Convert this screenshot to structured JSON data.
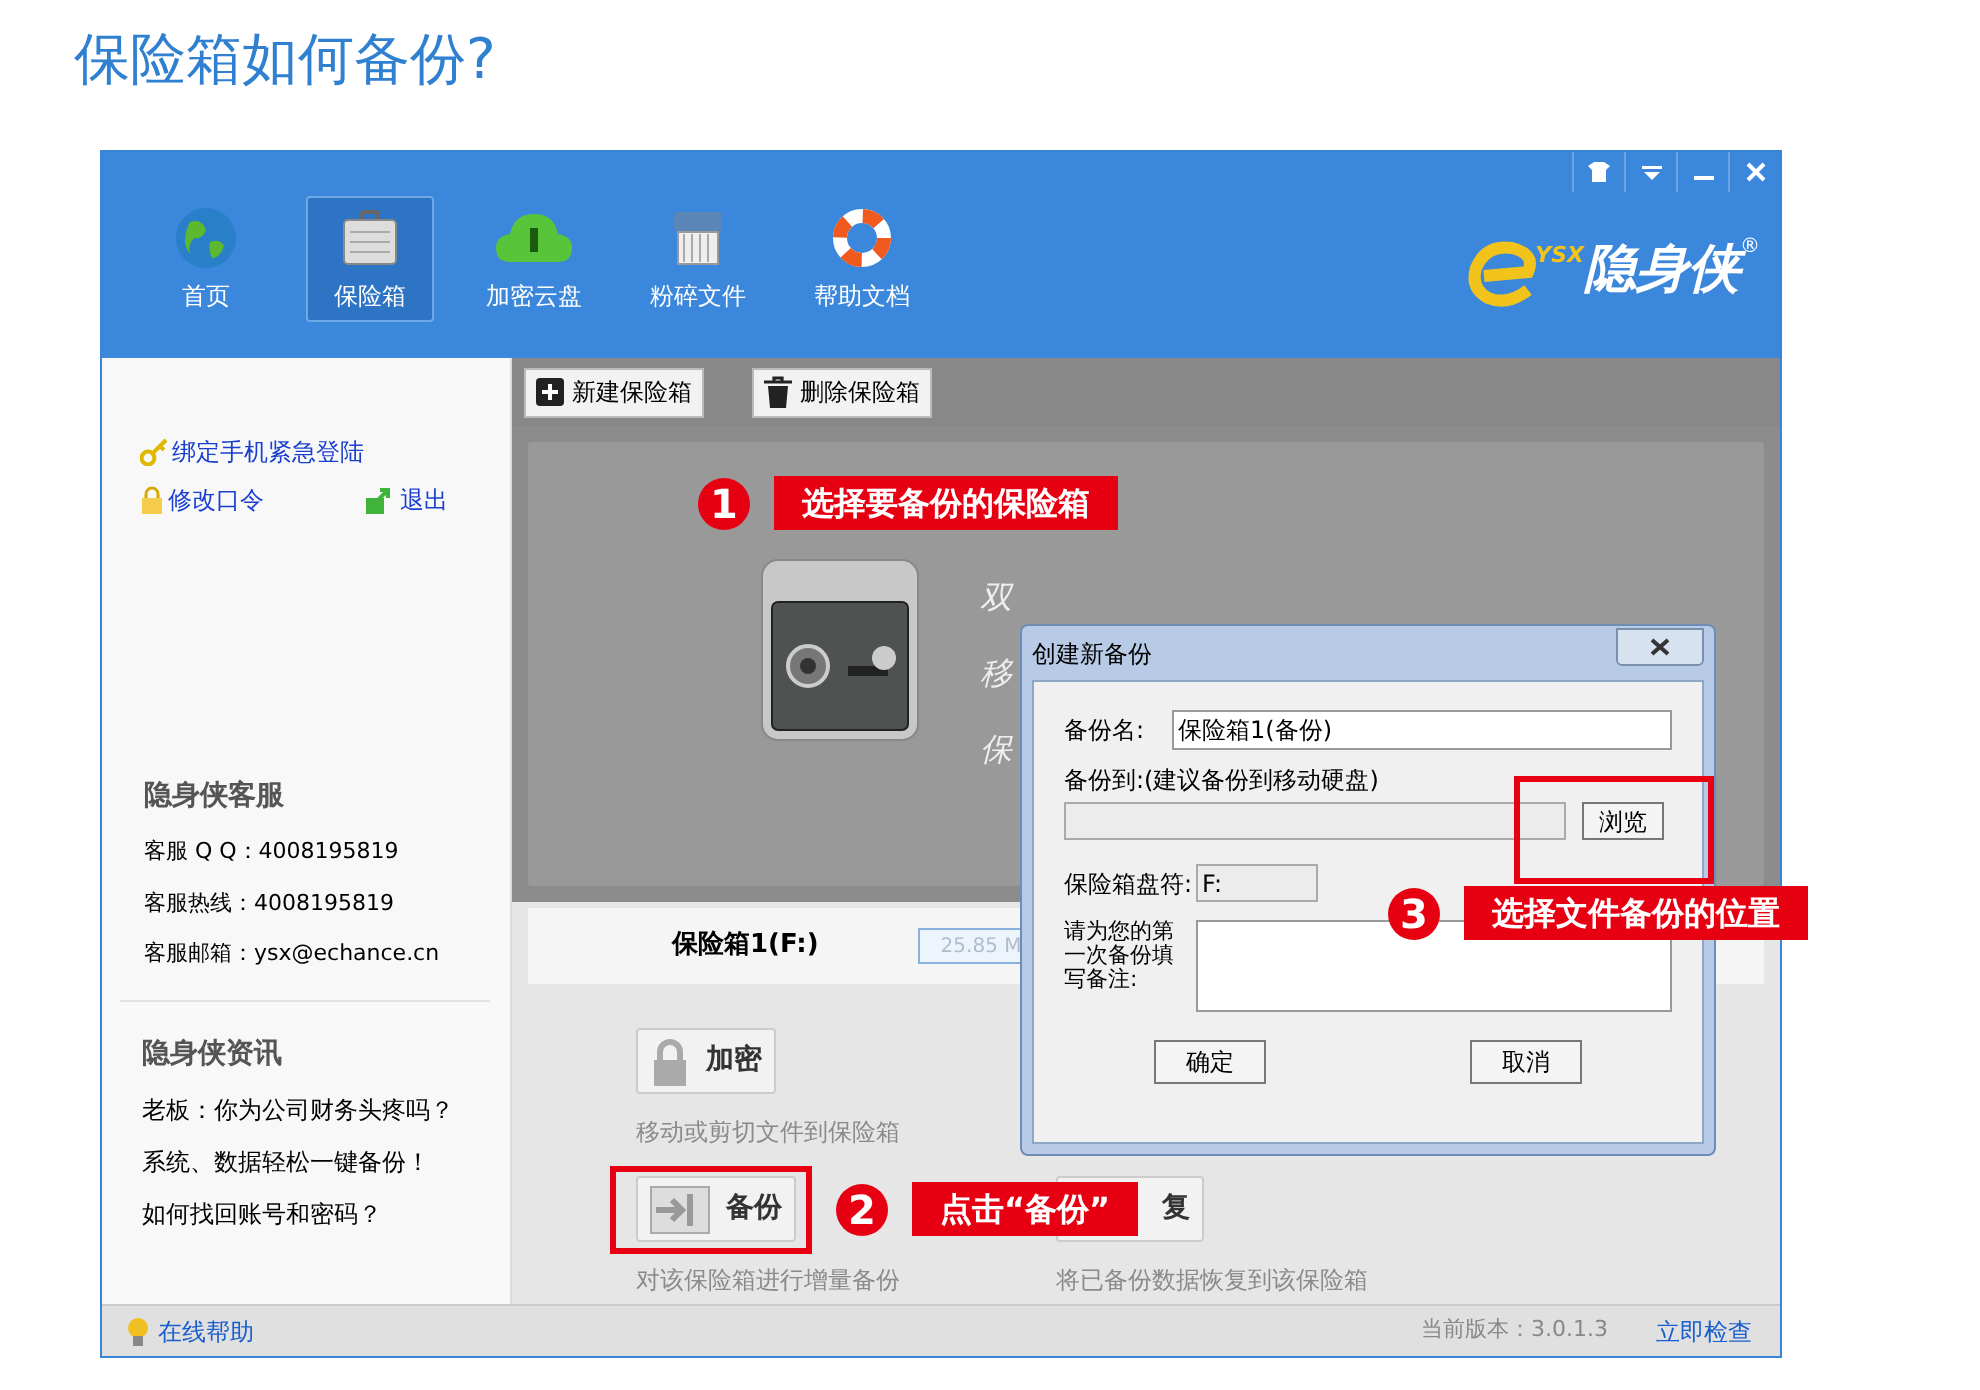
{
  "page_title": "保险箱如何备份?",
  "toolbar": [
    {
      "label": "首页",
      "selected": false
    },
    {
      "label": "保险箱",
      "selected": true
    },
    {
      "label": "加密云盘",
      "selected": false
    },
    {
      "label": "粉碎文件",
      "selected": false
    },
    {
      "label": "帮助文档",
      "selected": false
    }
  ],
  "logo": {
    "tag": "YSX",
    "name": "隐身侠",
    "reg": "®"
  },
  "sidebar": {
    "links": [
      "绑定手机紧急登陆",
      "修改口令",
      "退出"
    ],
    "service": {
      "title": "隐身侠客服",
      "lines": [
        "客服 Q Q：4008195819",
        "客服热线：4008195819",
        "客服邮箱：ysx@echance.cn"
      ]
    },
    "news": {
      "title": "隐身侠资讯",
      "items": [
        "老板：你为公司财务头疼吗？",
        "系统、数据轻松一键备份！",
        "如何找回账号和密码？"
      ]
    }
  },
  "main": {
    "toolbar_buttons": [
      "新建保险箱",
      "删除保险箱"
    ],
    "banner_lines": [
      "双",
      "移",
      "保"
    ],
    "safe": {
      "name": "保险箱1(F:)",
      "size": "25.85 M"
    },
    "actions": [
      {
        "label": "加密",
        "description": "移动或剪切文件到保险箱"
      },
      {
        "label": "备份",
        "description": "对该保险箱进行增量备份"
      },
      {
        "label": "复",
        "description": "将已备份数据恢复到该保险箱"
      }
    ]
  },
  "status_bar": {
    "help": "在线帮助",
    "version": "当前版本：3.0.1.3",
    "check": "立即检查"
  },
  "dialog": {
    "title": "创建新备份",
    "name_label": "备份名:",
    "name_value": "保险箱1(备份)",
    "dest_label": "备份到:(建议备份到移动硬盘)",
    "browse": "浏览",
    "drive_label": "保险箱盘符:",
    "drive_value": "F:",
    "note_label": "请为您的第一次备份填写备注:",
    "ok": "确定",
    "cancel": "取消"
  },
  "annotations": [
    {
      "number": "1",
      "text": "选择要备份的保险箱"
    },
    {
      "number": "2",
      "text": "点击“备份”"
    },
    {
      "number": "3",
      "text": "选择文件备份的位置"
    }
  ]
}
